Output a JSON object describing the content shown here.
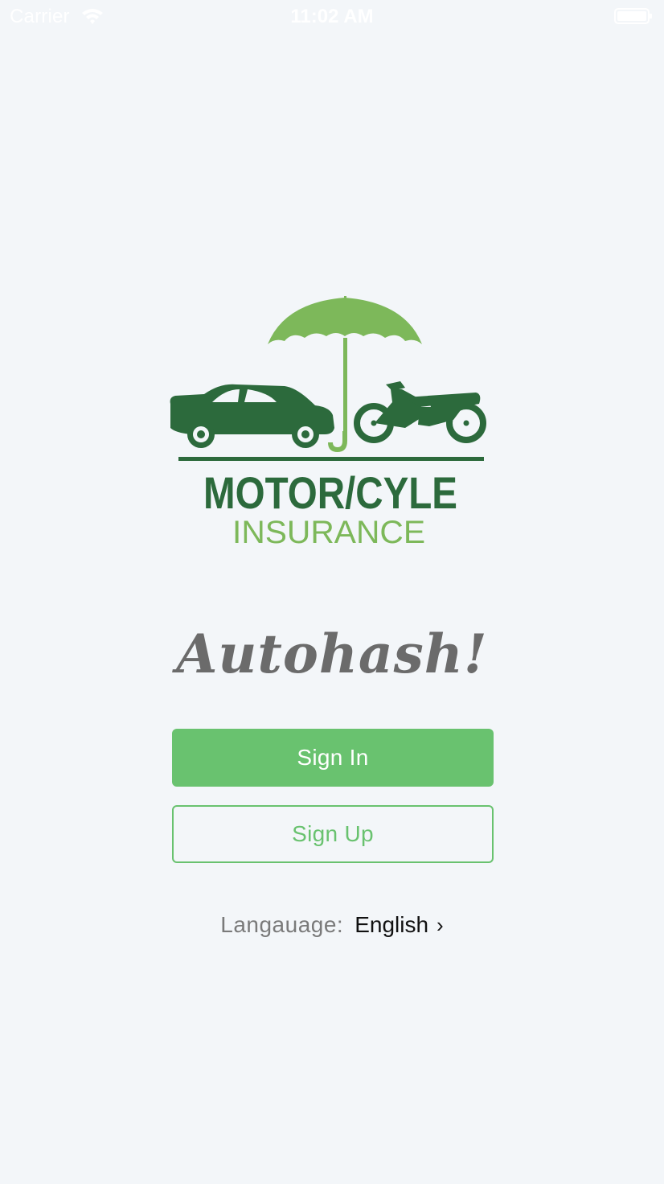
{
  "status_bar": {
    "carrier": "Carrier",
    "time": "11:02 AM",
    "wifi_icon": "wifi-icon",
    "battery_icon": "battery-icon"
  },
  "logo": {
    "name": "motor-cycle-insurance-logo",
    "line1": "MOTOR/CYLE",
    "line2": "INSURANCE",
    "colors": {
      "dark_green": "#2c6a3c",
      "light_green": "#7db85a"
    }
  },
  "tagline": "Autohash!",
  "buttons": {
    "sign_in": "Sign In",
    "sign_up": "Sign Up"
  },
  "language": {
    "label": "Langauage:",
    "value": "English",
    "chevron": "›"
  },
  "colors": {
    "background": "#f3f6f9",
    "accent": "#69c26f"
  }
}
